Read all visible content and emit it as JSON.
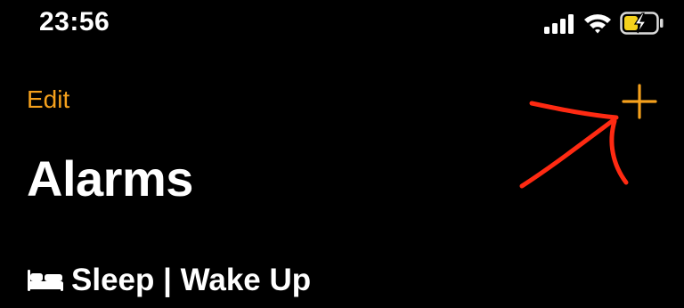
{
  "status_bar": {
    "time": "23:56",
    "icons": [
      "signal-bars-icon",
      "wifi-icon",
      "battery-charging-icon"
    ]
  },
  "nav": {
    "edit_label": "Edit",
    "add_icon": "plus-icon"
  },
  "page": {
    "title": "Alarms"
  },
  "section": {
    "icon": "bed-icon",
    "label": "Sleep | Wake Up"
  },
  "colors": {
    "background": "#000000",
    "accent": "#f4a01c",
    "text": "#ffffff",
    "annotation": "#ff2a12",
    "battery_fill": "#f5d21c"
  }
}
